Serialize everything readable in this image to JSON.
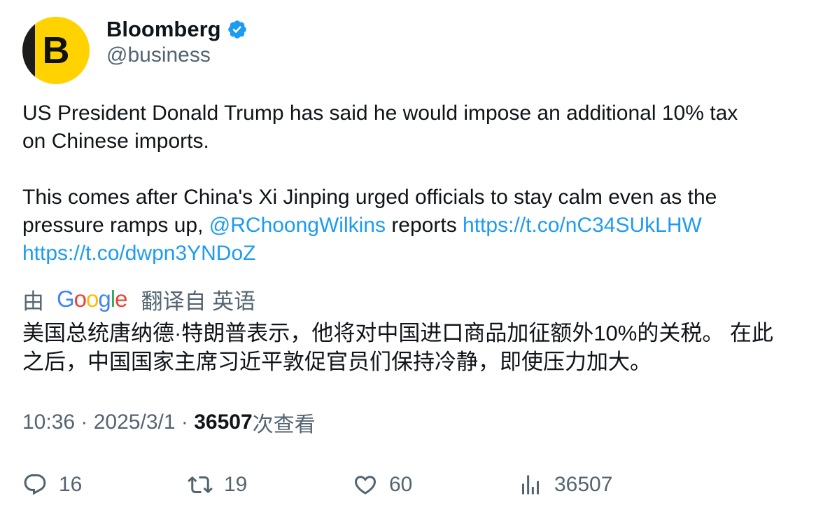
{
  "author": {
    "display_name": "Bloomberg",
    "handle": "@business",
    "avatar_letter": "B",
    "verified": true
  },
  "tweet": {
    "lines": [
      {
        "text": "US President Donald Trump has said he would impose an additional 10% tax"
      },
      {
        "text": "on Chinese imports."
      },
      {
        "text": ""
      },
      {
        "text": "This comes after China's Xi Jinping urged officials to stay calm even as the"
      }
    ],
    "line5_prefix": "pressure ramps up, ",
    "mention": "@RChoongWilkins",
    "line5_middle": " reports ",
    "link1": "https://t.co/nC34SUkLHW",
    "link2": "https://t.co/dwpn3YNDoZ"
  },
  "translation": {
    "by_label": "由",
    "provider": "Google",
    "from_label": "翻译自 英语",
    "lines": [
      "美国总统唐纳德·特朗普表示，他将对中国进口商品加征额外10%的关税。 在此",
      "之后，中国国家主席习近平敦促官员们保持冷静，即使压力加大。"
    ]
  },
  "meta": {
    "time": "10:36",
    "separator": " · ",
    "date": "2025/3/1",
    "views_count": "36507",
    "views_label": "次查看"
  },
  "actions": {
    "replies": "16",
    "retweets": "19",
    "likes": "60",
    "views": "36507"
  },
  "colors": {
    "link": "#1d9bf0",
    "secondary_text": "#536471",
    "verified_badge": "#1d9bf0",
    "avatar_bg": "#ffd200"
  }
}
